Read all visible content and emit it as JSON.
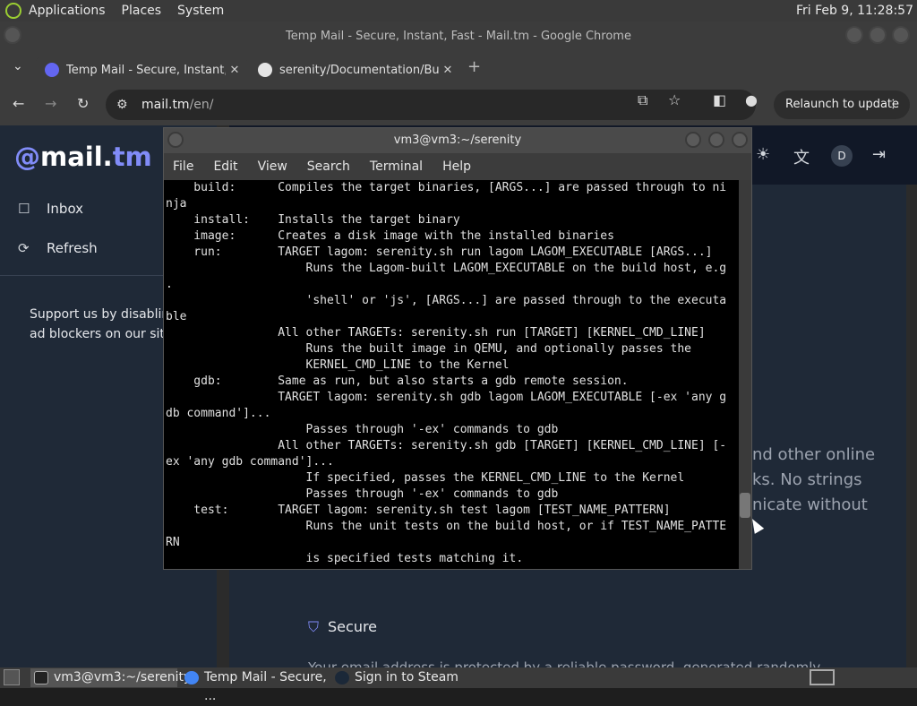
{
  "top_panel": {
    "menus": [
      "Applications",
      "Places",
      "System"
    ],
    "clock": "Fri Feb  9, 11:28:57"
  },
  "chrome": {
    "window_title": "Temp Mail - Secure, Instant, Fast - Mail.tm - Google Chrome",
    "tabs": [
      {
        "title": "Temp Mail - Secure, Instant, Fast - Mail.tm",
        "close": "✕"
      },
      {
        "title": "serenity/Documentation/BuildInstructions",
        "close": "✕"
      }
    ],
    "new_tab": "+",
    "url_host": "mail.tm",
    "url_path": "/en/",
    "relaunch_label": "Relaunch to update",
    "relaunch_menu": "⋮"
  },
  "mailtm": {
    "logo_at": "@",
    "logo_text": "mail.",
    "logo_tm": "tm",
    "sidebar": [
      {
        "label": "Inbox",
        "icon": "inbox-icon"
      },
      {
        "label": "Refresh",
        "icon": "refresh-icon"
      }
    ],
    "support_line1": "Support us by disablin",
    "support_line2": "ad blockers on our site",
    "avatar": "D",
    "main_lines": [
      "nd other online",
      "ks. No strings",
      "nicate without"
    ],
    "secure_label": "Secure",
    "secure_text": "Your email address is protected by a reliable password, generated randomly"
  },
  "terminal": {
    "title": "vm3@vm3:~/serenity",
    "menu": [
      "File",
      "Edit",
      "View",
      "Search",
      "Terminal",
      "Help"
    ],
    "lines": [
      "    build:      Compiles the target binaries, [ARGS...] are passed through to ni",
      "nja",
      "    install:    Installs the target binary",
      "    image:      Creates a disk image with the installed binaries",
      "    run:        TARGET lagom: serenity.sh run lagom LAGOM_EXECUTABLE [ARGS...]",
      "                    Runs the Lagom-built LAGOM_EXECUTABLE on the build host, e.g",
      ".",
      "                    'shell' or 'js', [ARGS...] are passed through to the executa",
      "ble",
      "                All other TARGETs: serenity.sh run [TARGET] [KERNEL_CMD_LINE]",
      "                    Runs the built image in QEMU, and optionally passes the",
      "                    KERNEL_CMD_LINE to the Kernel",
      "    gdb:        Same as run, but also starts a gdb remote session.",
      "                TARGET lagom: serenity.sh gdb lagom LAGOM_EXECUTABLE [-ex 'any g",
      "db command']...",
      "                    Passes through '-ex' commands to gdb",
      "                All other TARGETs: serenity.sh gdb [TARGET] [KERNEL_CMD_LINE] [-",
      "ex 'any gdb command']...",
      "                    If specified, passes the KERNEL_CMD_LINE to the Kernel",
      "                    Passes through '-ex' commands to gdb",
      "    test:       TARGET lagom: serenity.sh test lagom [TEST_NAME_PATTERN]",
      "                    Runs the unit tests on the build host, or if TEST_NAME_PATTE",
      "RN",
      "                    is specified tests matching it."
    ]
  },
  "taskbar": {
    "tasks": [
      {
        "label": "vm3@vm3:~/serenity",
        "icon": "terminal-icon"
      },
      {
        "label": "Temp Mail - Secure, ...",
        "icon": "chrome-icon"
      },
      {
        "label": "Sign in to Steam",
        "icon": "steam-icon"
      }
    ]
  }
}
